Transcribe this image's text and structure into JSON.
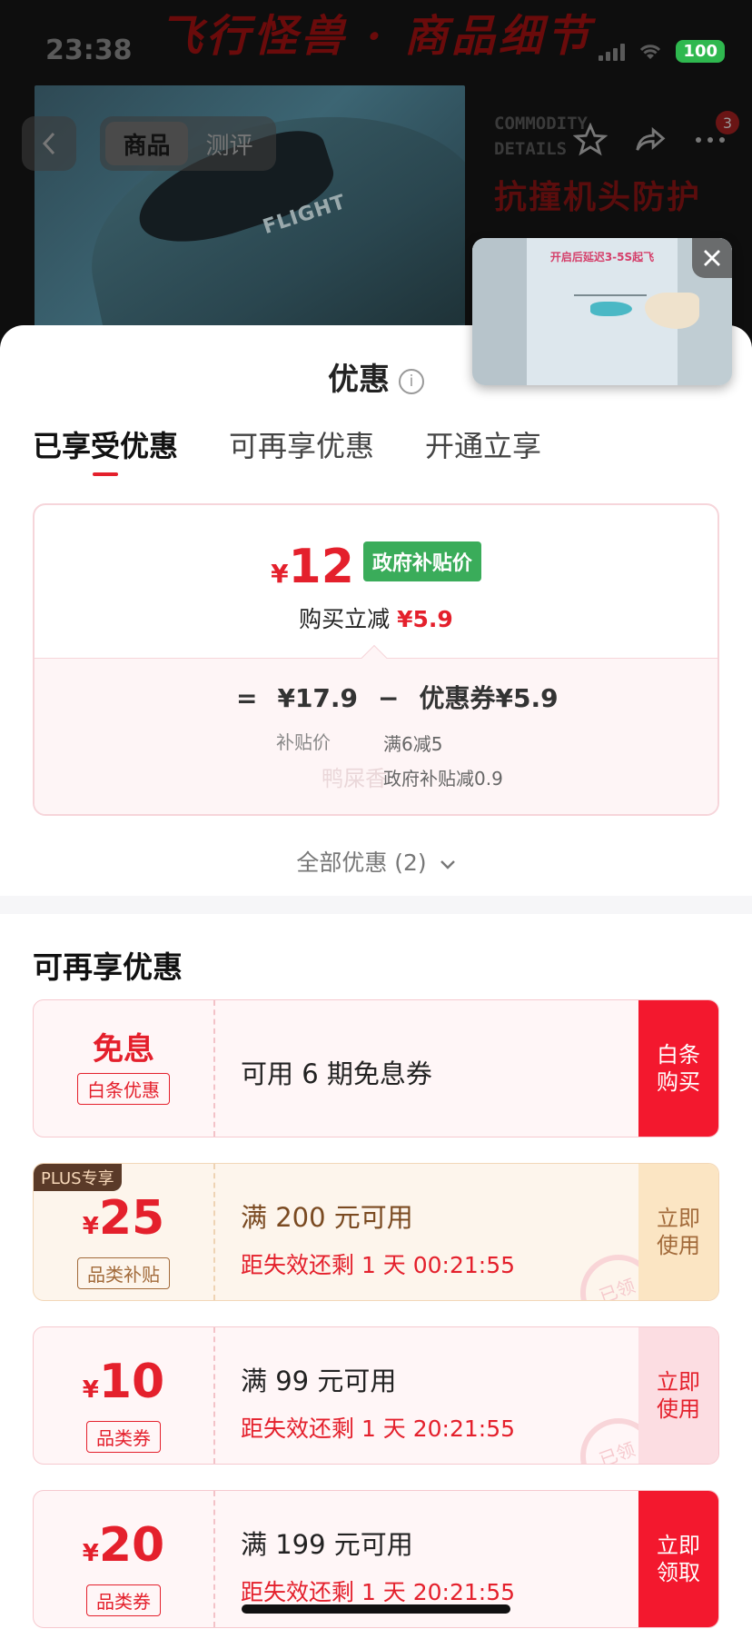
{
  "status_bar": {
    "time": "23:38",
    "battery": "100"
  },
  "product_banner": {
    "title": "飞行怪兽 · 商品细节",
    "commodity_line1": "COMMODITY",
    "commodity_line2": "DETAILS",
    "feature": "抗撞机头防护",
    "image_label": "FLIGHT"
  },
  "nav": {
    "tabs": [
      "商品",
      "测评"
    ],
    "active_tab": 0,
    "badge_count": "3"
  },
  "video": {
    "caption": "开启后延迟3-5S起飞"
  },
  "sheet": {
    "title": "优惠",
    "tabs": [
      "已享受优惠",
      "可再享优惠",
      "开通立享"
    ],
    "active_tab": 0,
    "summary": {
      "currency": "¥",
      "final_price": "12",
      "price_badge": "政府补贴价",
      "reduce_label": "购买立减",
      "reduce_value": "¥5.9",
      "equals": "=",
      "subsidy_price": "¥17.9",
      "minus": "−",
      "coupon_total": "优惠券¥5.9",
      "subsidy_label": "补贴价",
      "detail_1": "满6减5",
      "detail_2": "政府补贴减0.9",
      "watermark": "鸭屎香"
    },
    "all_discounts": "全部优惠 (2)",
    "section_title": "可再享优惠",
    "coupons": [
      {
        "amount": "免息",
        "tag": "白条优惠",
        "condition": "可用 6 期免息券",
        "expire": "",
        "action": "白条购买",
        "style": "red"
      },
      {
        "amount": "25",
        "tag": "品类补贴",
        "condition": "满 200 元可用",
        "expire": "距失效还剩 1 天 00:21:55",
        "action": "立即使用",
        "plus": "PLUS专享",
        "stamp": "已领",
        "style": "plus"
      },
      {
        "amount": "10",
        "tag": "品类券",
        "condition": "满 99 元可用",
        "expire": "距失效还剩 1 天 20:21:55",
        "action": "立即使用",
        "stamp": "已领",
        "style": "pink"
      },
      {
        "amount": "20",
        "tag": "品类券",
        "condition": "满 199 元可用",
        "expire": "距失效还剩 1 天 20:21:55",
        "action": "立即领取",
        "style": "red"
      }
    ]
  },
  "colors": {
    "accent_red": "#e4202c",
    "gov_green": "#3aac5a",
    "plus_brown": "#5a3a28"
  }
}
